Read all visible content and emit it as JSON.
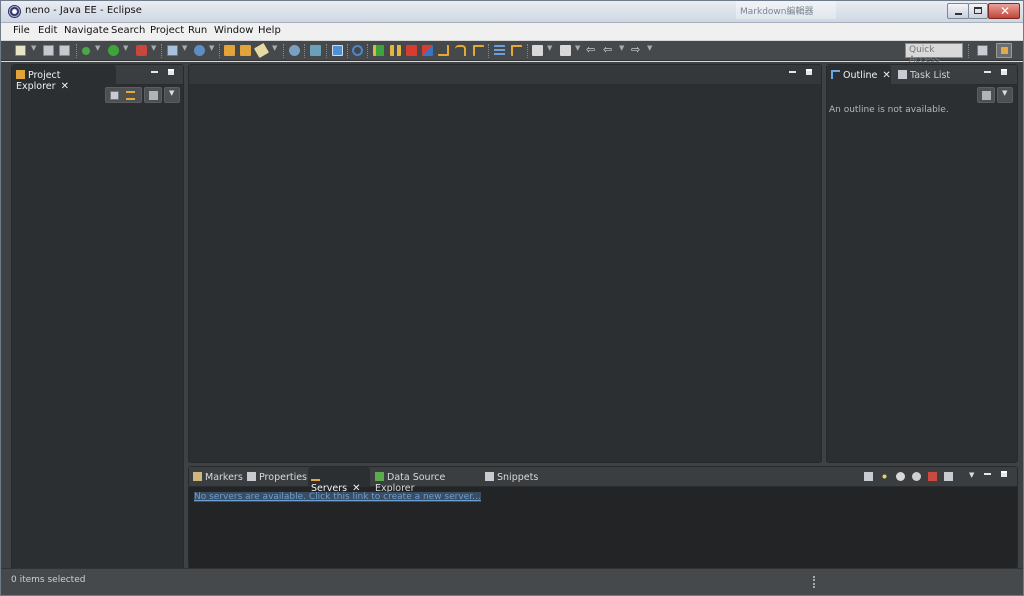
{
  "window": {
    "title": "neno - Java EE - Eclipse",
    "background_tab": "Markdown編輯器"
  },
  "menu": [
    "File",
    "Edit",
    "Navigate",
    "Search",
    "Project",
    "Run",
    "Window",
    "Help"
  ],
  "toolbar": {
    "quick_access_placeholder": "Quick Access",
    "icons": [
      "new-icon",
      "save-icon",
      "save-all-icon",
      "debug-icon",
      "run-icon",
      "external-tools-icon",
      "new-server-icon",
      "new-web-service-icon",
      "open-type-icon",
      "open-task-icon",
      "search-icon",
      "web-browser-icon",
      "deploy-icon",
      "publish-icon",
      "skip-breakpoints-icon",
      "resume-icon",
      "suspend-icon",
      "terminate-icon",
      "disconnect-icon",
      "step-into-icon",
      "step-over-icon",
      "step-return-icon",
      "drop-to-frame-icon",
      "use-step-filters-icon",
      "next-annotation-icon",
      "previous-annotation-icon",
      "last-edit-location-icon",
      "back-icon",
      "forward-icon",
      "perspective-icon",
      "java-ee-perspective-icon"
    ]
  },
  "project_explorer": {
    "tab_label": "Project Explorer"
  },
  "outline": {
    "tabs": [
      {
        "label": "Outline",
        "active": true
      },
      {
        "label": "Task List",
        "active": false
      }
    ],
    "message": "An outline is not available."
  },
  "bottom_panel": {
    "tabs": [
      {
        "label": "Markers",
        "active": false
      },
      {
        "label": "Properties",
        "active": false
      },
      {
        "label": "Servers",
        "active": true
      },
      {
        "label": "Data Source Explorer",
        "active": false
      },
      {
        "label": "Snippets",
        "active": false
      }
    ],
    "link_text": "No servers are available. Click this link to create a new server..."
  },
  "status": {
    "text": "0 items selected"
  },
  "colors": {
    "workbench_bg": "#3e4245",
    "panel_bg": "#2c2f31",
    "toolbar_bg": "#45494c",
    "link": "#6f9fd0"
  }
}
